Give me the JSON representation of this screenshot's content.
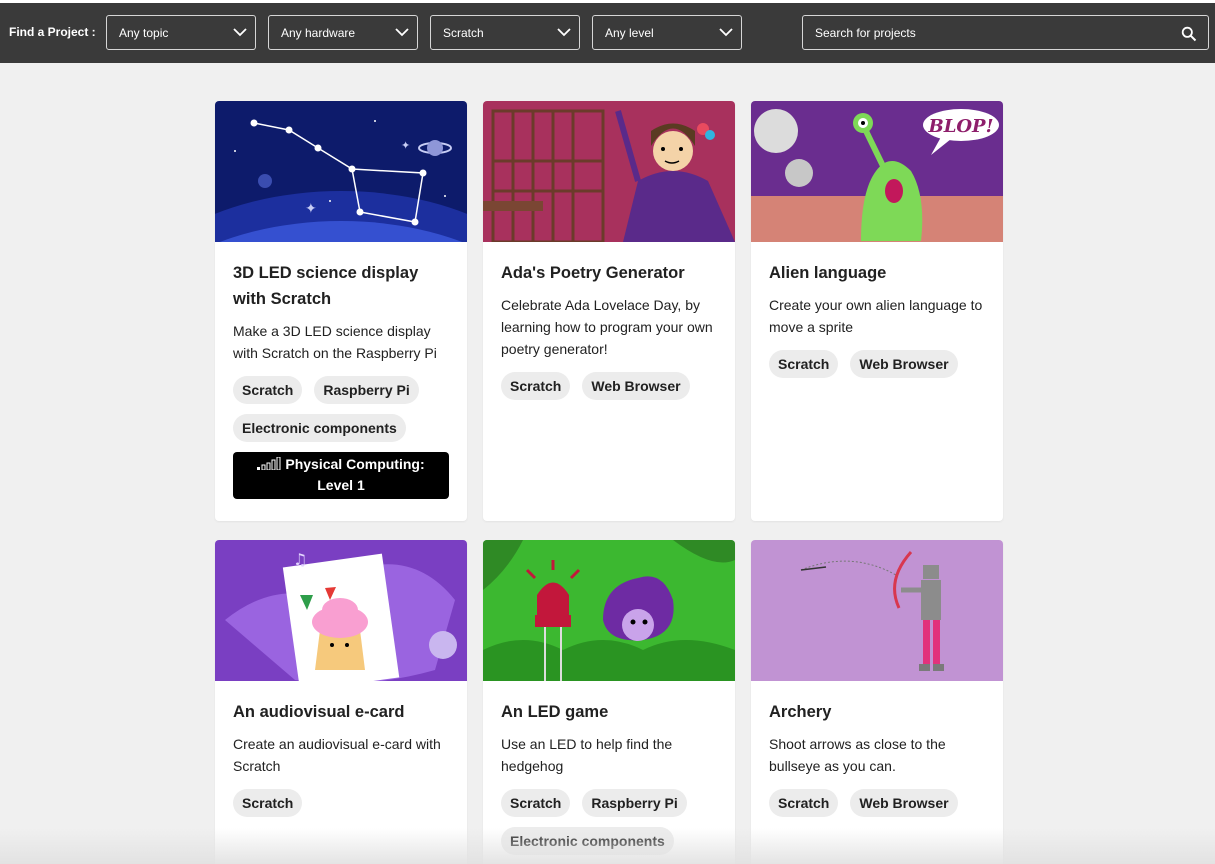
{
  "filters": {
    "label": "Find a Project :",
    "topic": "Any topic",
    "hardware": "Any hardware",
    "software": "Scratch",
    "level": "Any level",
    "search_placeholder": "Search for projects"
  },
  "projects": [
    {
      "title": "3D LED science display with Scratch",
      "description": "Make a 3D LED science display with Scratch on the Raspberry Pi",
      "tags": [
        "Scratch",
        "Raspberry Pi",
        "Electronic components"
      ],
      "level": "Physical Computing: Level 1"
    },
    {
      "title": "Ada's Poetry Generator",
      "description": "Celebrate Ada Lovelace Day, by learning how to program your own poetry generator!",
      "tags": [
        "Scratch",
        "Web Browser"
      ]
    },
    {
      "title": "Alien language",
      "description": "Create your own alien language to move a sprite",
      "tags": [
        "Scratch",
        "Web Browser"
      ],
      "image_text": "BLOP!"
    },
    {
      "title": "An audiovisual e-card",
      "description": "Create an audiovisual e-card with Scratch",
      "tags": [
        "Scratch"
      ]
    },
    {
      "title": "An LED game",
      "description": "Use an LED to help find the hedgehog",
      "tags": [
        "Scratch",
        "Raspberry Pi",
        "Electronic components"
      ]
    },
    {
      "title": "Archery",
      "description": "Shoot arrows as close to the bullseye as you can.",
      "tags": [
        "Scratch",
        "Web Browser"
      ]
    }
  ],
  "icons": {
    "dropdown": "chevron-down-icon",
    "search": "search-icon",
    "level": "signal-bars-icon"
  },
  "colors": {
    "filter_bar": "#3a3a3a",
    "page_bg": "#f0f0f0",
    "tag_bg": "#ececec",
    "level_badge": "#000000"
  }
}
